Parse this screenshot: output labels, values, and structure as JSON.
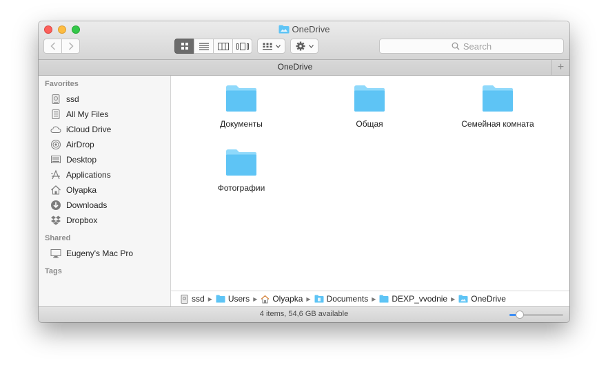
{
  "window": {
    "title": "OneDrive"
  },
  "toolbar": {
    "back_icon": "chevron-left-icon",
    "forward_icon": "chevron-right-icon",
    "view_modes": [
      "icon-view",
      "list-view",
      "column-view",
      "cover-flow-view"
    ],
    "active_view": "icon-view",
    "search": {
      "placeholder": "Search"
    }
  },
  "tab": {
    "label": "OneDrive",
    "add_label": "+"
  },
  "sidebar": {
    "sections": [
      {
        "heading": "Favorites",
        "items": [
          {
            "label": "ssd",
            "icon": "disk-icon"
          },
          {
            "label": "All My Files",
            "icon": "all-files-icon"
          },
          {
            "label": "iCloud Drive",
            "icon": "cloud-icon"
          },
          {
            "label": "AirDrop",
            "icon": "airdrop-icon"
          },
          {
            "label": "Desktop",
            "icon": "desktop-icon"
          },
          {
            "label": "Applications",
            "icon": "applications-icon"
          },
          {
            "label": "Olyapka",
            "icon": "home-icon"
          },
          {
            "label": "Downloads",
            "icon": "downloads-icon"
          },
          {
            "label": "Dropbox",
            "icon": "dropbox-icon"
          }
        ]
      },
      {
        "heading": "Shared",
        "items": [
          {
            "label": "Eugeny's Mac Pro",
            "icon": "computer-icon"
          }
        ]
      },
      {
        "heading": "Tags",
        "items": []
      }
    ]
  },
  "files": [
    {
      "name": "Документы",
      "icon": "folder-icon"
    },
    {
      "name": "Общая",
      "icon": "folder-icon"
    },
    {
      "name": "Семейная комната",
      "icon": "folder-icon"
    },
    {
      "name": "Фотографии",
      "icon": "folder-icon"
    }
  ],
  "path": [
    {
      "label": "ssd",
      "icon": "disk-icon"
    },
    {
      "label": "Users",
      "icon": "folder-icon"
    },
    {
      "label": "Olyapka",
      "icon": "home-icon"
    },
    {
      "label": "Documents",
      "icon": "documents-folder-icon"
    },
    {
      "label": "DEXP_vvodnie",
      "icon": "folder-icon"
    },
    {
      "label": "OneDrive",
      "icon": "onedrive-folder-icon"
    }
  ],
  "status": {
    "text": "4 items, 54,6 GB available",
    "icon_size_fraction": 0.19
  },
  "colors": {
    "folder_top": "#8fd9fb",
    "folder_body": "#5ec4f5",
    "accent": "#3d8ff6"
  }
}
